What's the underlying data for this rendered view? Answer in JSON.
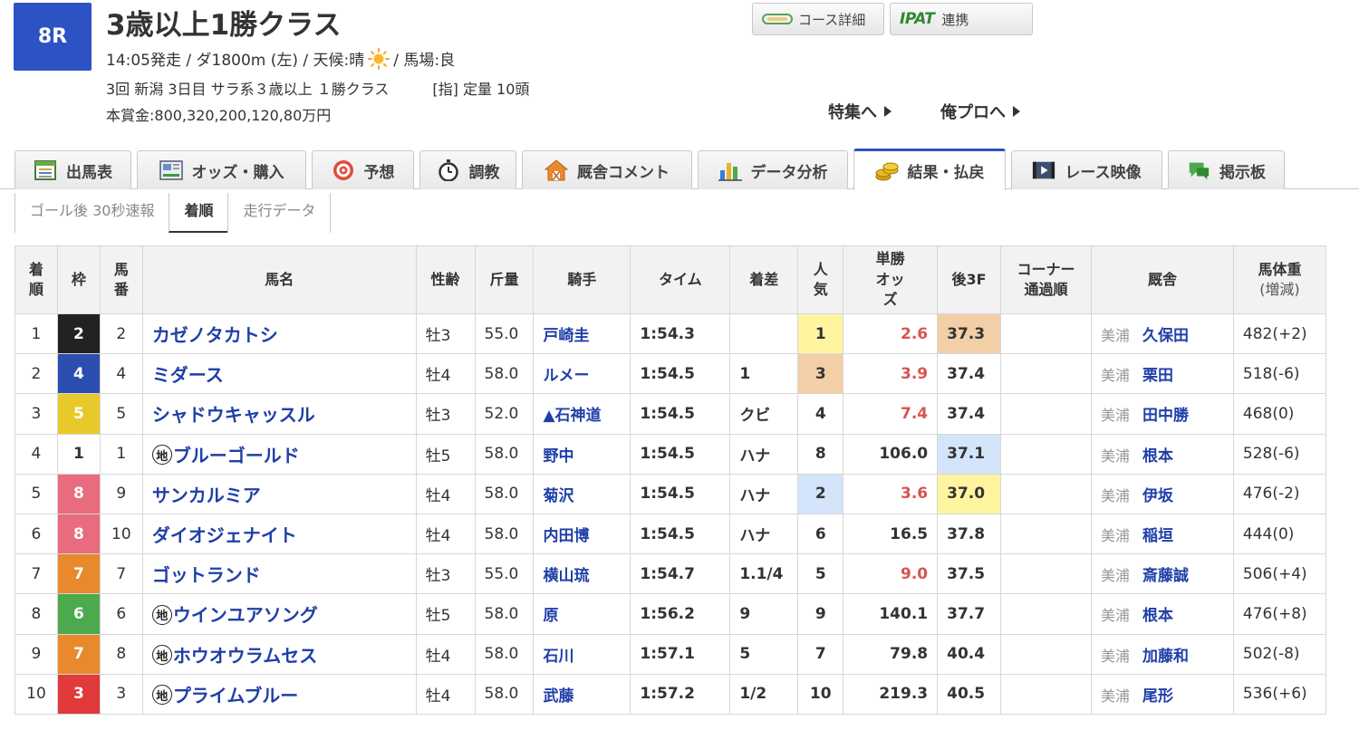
{
  "race": {
    "number": "8R",
    "title": "3歳以上1勝クラス",
    "info_pre": "14:05発走 / ダ1800m (左) / 天候:晴",
    "info_post": "/ 馬場:良",
    "info2": "3回 新潟 3日目 サラ系３歳以上 １勝クラス　　　[指] 定量 10頭",
    "prize": "本賞金:800,320,200,120,80万円",
    "weather_icon": "sun-icon"
  },
  "buttons": {
    "course": "コース詳細",
    "ipat_logo": "IPAT",
    "ipat": "連携"
  },
  "links": {
    "feature": "特集へ",
    "orepro": "俺プロへ"
  },
  "tabs": [
    {
      "label": "出馬表",
      "icon": "entry-table-icon"
    },
    {
      "label": "オッズ・購入",
      "icon": "ipat-ticket-icon"
    },
    {
      "label": "予想",
      "icon": "target-icon"
    },
    {
      "label": "調教",
      "icon": "stopwatch-icon"
    },
    {
      "label": "厩舎コメント",
      "icon": "stable-icon"
    },
    {
      "label": "データ分析",
      "icon": "bar-chart-icon"
    },
    {
      "label": "結果・払戻",
      "icon": "coins-icon",
      "active": true
    },
    {
      "label": "レース映像",
      "icon": "video-icon"
    },
    {
      "label": "掲示板",
      "icon": "chat-bubble-icon"
    }
  ],
  "subtabs": [
    "ゴール後 30秒速報",
    "着順",
    "走行データ"
  ],
  "columns": {
    "rank": "着順",
    "waku": "枠",
    "umaban": "馬番",
    "horse": "馬名",
    "sexage": "性齢",
    "kinryo": "斤量",
    "jockey": "騎手",
    "time": "タイム",
    "margin": "着差",
    "popularity": "人気",
    "odds": "単勝オッズ",
    "last3f": "後3F",
    "corner": "コーナー通過順",
    "trainer": "厩舎",
    "weight": "馬体重",
    "weight_sub": "(増減)"
  },
  "waku_colors": {
    "1": {
      "bg": "#ffffff",
      "fg": "#333333"
    },
    "2": {
      "bg": "#222222",
      "fg": "#ffffff"
    },
    "3": {
      "bg": "#e03a3a",
      "fg": "#ffffff"
    },
    "4": {
      "bg": "#2b4eb0",
      "fg": "#ffffff"
    },
    "5": {
      "bg": "#e8c92a",
      "fg": "#ffffff"
    },
    "6": {
      "bg": "#4caa4c",
      "fg": "#ffffff"
    },
    "7": {
      "bg": "#e8892e",
      "fg": "#ffffff"
    },
    "8": {
      "bg": "#e86c7e",
      "fg": "#ffffff"
    }
  },
  "rows": [
    {
      "rank": "1",
      "waku": "2",
      "umaban": "2",
      "chihou": false,
      "horse": "カゼノタカトシ",
      "sexage": "牡3",
      "kinryo": "55.0",
      "jockey": "戸崎圭",
      "time": "1:54.3",
      "margin": "",
      "pop": "1",
      "pop_hl": "yellow",
      "odds": "2.6",
      "odds_red": true,
      "f3": "37.3",
      "f3_hl": "orange",
      "corner": "",
      "stable": "美浦",
      "trainer": "久保田",
      "weight": "482(+2)"
    },
    {
      "rank": "2",
      "waku": "4",
      "umaban": "4",
      "chihou": false,
      "horse": "ミダース",
      "sexage": "牡4",
      "kinryo": "58.0",
      "jockey": "ルメー",
      "time": "1:54.5",
      "margin": "1",
      "pop": "3",
      "pop_hl": "orange",
      "odds": "3.9",
      "odds_red": true,
      "f3": "37.4",
      "f3_hl": "",
      "corner": "",
      "stable": "美浦",
      "trainer": "栗田",
      "weight": "518(-6)"
    },
    {
      "rank": "3",
      "waku": "5",
      "umaban": "5",
      "chihou": false,
      "horse": "シャドウキャッスル",
      "sexage": "牡3",
      "kinryo": "52.0",
      "jockey": "▲石神道",
      "time": "1:54.5",
      "margin": "クビ",
      "pop": "4",
      "pop_hl": "",
      "odds": "7.4",
      "odds_red": true,
      "f3": "37.4",
      "f3_hl": "",
      "corner": "",
      "stable": "美浦",
      "trainer": "田中勝",
      "weight": "468(0)"
    },
    {
      "rank": "4",
      "waku": "1",
      "umaban": "1",
      "chihou": true,
      "horse": "ブルーゴールド",
      "sexage": "牡5",
      "kinryo": "58.0",
      "jockey": "野中",
      "time": "1:54.5",
      "margin": "ハナ",
      "pop": "8",
      "pop_hl": "",
      "odds": "106.0",
      "odds_red": false,
      "f3": "37.1",
      "f3_hl": "blue",
      "corner": "",
      "stable": "美浦",
      "trainer": "根本",
      "weight": "528(-6)"
    },
    {
      "rank": "5",
      "waku": "8",
      "umaban": "9",
      "chihou": false,
      "horse": "サンカルミア",
      "sexage": "牡4",
      "kinryo": "58.0",
      "jockey": "菊沢",
      "time": "1:54.5",
      "margin": "ハナ",
      "pop": "2",
      "pop_hl": "blue",
      "odds": "3.6",
      "odds_red": true,
      "f3": "37.0",
      "f3_hl": "yellow",
      "corner": "",
      "stable": "美浦",
      "trainer": "伊坂",
      "weight": "476(-2)"
    },
    {
      "rank": "6",
      "waku": "8",
      "umaban": "10",
      "chihou": false,
      "horse": "ダイオジェナイト",
      "sexage": "牡4",
      "kinryo": "58.0",
      "jockey": "内田博",
      "time": "1:54.5",
      "margin": "ハナ",
      "pop": "6",
      "pop_hl": "",
      "odds": "16.5",
      "odds_red": false,
      "f3": "37.8",
      "f3_hl": "",
      "corner": "",
      "stable": "美浦",
      "trainer": "稲垣",
      "weight": "444(0)"
    },
    {
      "rank": "7",
      "waku": "7",
      "umaban": "7",
      "chihou": false,
      "horse": "ゴットランド",
      "sexage": "牡3",
      "kinryo": "55.0",
      "jockey": "横山琉",
      "time": "1:54.7",
      "margin": "1.1/4",
      "pop": "5",
      "pop_hl": "",
      "odds": "9.0",
      "odds_red": true,
      "f3": "37.5",
      "f3_hl": "",
      "corner": "",
      "stable": "美浦",
      "trainer": "斎藤誠",
      "weight": "506(+4)"
    },
    {
      "rank": "8",
      "waku": "6",
      "umaban": "6",
      "chihou": true,
      "horse": "ウインユアソング",
      "sexage": "牡5",
      "kinryo": "58.0",
      "jockey": "原",
      "time": "1:56.2",
      "margin": "9",
      "pop": "9",
      "pop_hl": "",
      "odds": "140.1",
      "odds_red": false,
      "f3": "37.7",
      "f3_hl": "",
      "corner": "",
      "stable": "美浦",
      "trainer": "根本",
      "weight": "476(+8)"
    },
    {
      "rank": "9",
      "waku": "7",
      "umaban": "8",
      "chihou": true,
      "horse": "ホウオウラムセス",
      "sexage": "牡4",
      "kinryo": "58.0",
      "jockey": "石川",
      "time": "1:57.1",
      "margin": "5",
      "pop": "7",
      "pop_hl": "",
      "odds": "79.8",
      "odds_red": false,
      "f3": "40.4",
      "f3_hl": "",
      "corner": "",
      "stable": "美浦",
      "trainer": "加藤和",
      "weight": "502(-8)"
    },
    {
      "rank": "10",
      "waku": "3",
      "umaban": "3",
      "chihou": true,
      "horse": "プライムブルー",
      "sexage": "牡4",
      "kinryo": "58.0",
      "jockey": "武藤",
      "time": "1:57.2",
      "margin": "1/2",
      "pop": "10",
      "pop_hl": "",
      "odds": "219.3",
      "odds_red": false,
      "f3": "40.5",
      "f3_hl": "",
      "corner": "",
      "stable": "美浦",
      "trainer": "尾形",
      "weight": "536(+6)"
    }
  ],
  "chihou_mark": "地"
}
